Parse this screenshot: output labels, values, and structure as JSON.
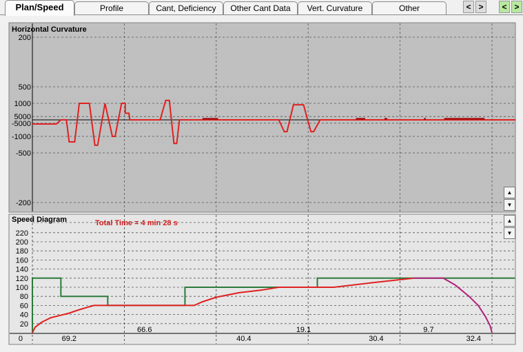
{
  "tabs": [
    {
      "label": "Plan/Speed",
      "active": true
    },
    {
      "label": "Profile"
    },
    {
      "label": "Cant, Deficiency"
    },
    {
      "label": "Other Cant Data"
    },
    {
      "label": "Vert. Curvature"
    },
    {
      "label": "Other"
    }
  ],
  "nav_buttons": {
    "prev": "<",
    "next": ">",
    "green_prev": "<",
    "green_next": ">"
  },
  "colors": {
    "curvature": "#e02020",
    "speed_limit": "#2a7a3a",
    "actual_speed": "#e02020",
    "braking": "#b0207a",
    "plan_bg": "#c0c0c0",
    "speed_bg": "#e6e6e6"
  },
  "scroll_icons": {
    "up": "▲",
    "down": "▼"
  },
  "chart_data": [
    {
      "type": "line",
      "title": "Horizontal Curvature",
      "y_scale": "reciprocal (radius)",
      "ytick_labels": [
        "200",
        "500",
        "1000",
        "5000",
        "-5000",
        "-1000",
        "-500",
        "-200"
      ],
      "ytick_values": [
        200,
        500,
        1000,
        5000,
        -5000,
        -1000,
        -500,
        -200
      ],
      "xlim": [
        0,
        5.25
      ],
      "grid": true,
      "series": [
        {
          "points": [
            [
              0,
              -4000
            ],
            [
              0.26,
              -4000
            ],
            [
              0.31,
              null
            ],
            [
              0.37,
              null
            ],
            [
              0.4,
              -750
            ],
            [
              0.46,
              -750
            ],
            [
              0.51,
              1000
            ],
            [
              0.62,
              1000
            ],
            [
              0.68,
              -650
            ],
            [
              0.71,
              -650
            ],
            [
              0.79,
              1000
            ],
            [
              0.87,
              -1000
            ],
            [
              0.9,
              -1000
            ],
            [
              0.97,
              1000
            ],
            [
              1.01,
              1000
            ],
            [
              1.01,
              2500
            ],
            [
              1.05,
              2500
            ],
            [
              1.06,
              null
            ],
            [
              1.39,
              null
            ],
            [
              1.45,
              850
            ],
            [
              1.49,
              850
            ],
            [
              1.54,
              -700
            ],
            [
              1.57,
              -700
            ],
            [
              1.6,
              null
            ],
            [
              2.68,
              null
            ],
            [
              2.74,
              -1400
            ],
            [
              2.77,
              -1400
            ],
            [
              2.84,
              1100
            ],
            [
              2.95,
              1100
            ],
            [
              3.03,
              -1400
            ],
            [
              3.06,
              -1400
            ],
            [
              3.13,
              null
            ],
            [
              5.25,
              null
            ]
          ]
        }
      ],
      "dark_marks": [
        [
          1.85,
          2.02
        ],
        [
          3.52,
          3.62
        ],
        [
          3.83,
          3.86
        ],
        [
          4.26,
          4.28
        ],
        [
          4.48,
          4.92
        ]
      ]
    },
    {
      "type": "line",
      "title": "Speed Diagram",
      "annotation": "Total Time = 4 min 28 s",
      "ylim": [
        0,
        230
      ],
      "ytick_labels": [
        "0",
        "20",
        "40",
        "60",
        "80",
        "100",
        "120",
        "140",
        "160",
        "180",
        "200",
        "220"
      ],
      "ytick_values": [
        0,
        20,
        40,
        60,
        80,
        100,
        120,
        140,
        160,
        180,
        200,
        220
      ],
      "xlim": [
        0,
        5.25
      ],
      "grid": true,
      "speed_limit": [
        [
          0,
          0
        ],
        [
          0,
          120
        ],
        [
          0.31,
          120
        ],
        [
          0.31,
          80
        ],
        [
          0.82,
          80
        ],
        [
          0.82,
          60
        ],
        [
          1.66,
          60
        ],
        [
          1.66,
          100
        ],
        [
          3.1,
          100
        ],
        [
          3.1,
          120
        ],
        [
          5.25,
          120
        ]
      ],
      "actual_speed": [
        [
          0,
          0
        ],
        [
          0.03,
          12
        ],
        [
          0.1,
          23
        ],
        [
          0.2,
          33
        ],
        [
          0.3,
          38
        ],
        [
          0.4,
          43
        ],
        [
          0.5,
          50
        ],
        [
          0.6,
          56
        ],
        [
          0.67,
          60
        ],
        [
          1.76,
          60
        ],
        [
          1.85,
          68
        ],
        [
          2.0,
          78
        ],
        [
          2.25,
          88
        ],
        [
          2.5,
          94
        ],
        [
          2.68,
          100
        ],
        [
          3.28,
          100
        ],
        [
          3.7,
          110
        ],
        [
          4.15,
          120
        ]
      ],
      "braking": [
        [
          4.15,
          120
        ],
        [
          4.47,
          120
        ],
        [
          4.6,
          105
        ],
        [
          4.75,
          80
        ],
        [
          4.85,
          60
        ],
        [
          4.93,
          35
        ],
        [
          4.98,
          15
        ],
        [
          5.0,
          0
        ]
      ],
      "segment_times": [
        {
          "label": "69.2",
          "x": 0.4,
          "row": "lower"
        },
        {
          "label": "66.6",
          "x": 1.22,
          "row": "upper"
        },
        {
          "label": "40.4",
          "x": 2.3,
          "row": "lower"
        },
        {
          "label": "19.1",
          "x": 2.95,
          "row": "upper"
        },
        {
          "label": "30.4",
          "x": 3.74,
          "row": "lower"
        },
        {
          "label": "9.7",
          "x": 4.31,
          "row": "upper"
        },
        {
          "label": "32.4",
          "x": 4.8,
          "row": "lower"
        }
      ]
    }
  ]
}
